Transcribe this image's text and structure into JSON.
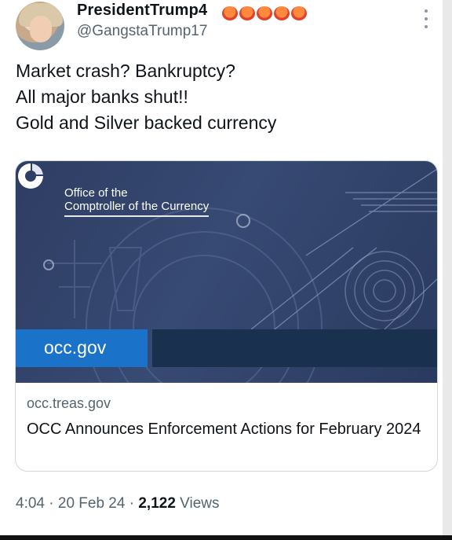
{
  "tweet": {
    "display_name": "PresidentTrump4",
    "handle": "@GangstaTrump17",
    "text_lines": [
      "Market crash? Bankruptcy?",
      "All major banks shut!!",
      "Gold and Silver backed currency"
    ],
    "emoji_icon": "orange-circle-emoji",
    "emoji_count": 5
  },
  "card": {
    "image": {
      "org_line1": "Office of the",
      "org_line2": "Comptroller of the Currency",
      "domain_badge": "occ.gov",
      "logo_icon": "occ-logo-icon",
      "colors": {
        "background": "#33456d",
        "badge": "#1a73c8",
        "dark_bar": "#19304f"
      }
    },
    "domain": "occ.treas.gov",
    "title": "OCC Announces Enforcement Actions for February 2024"
  },
  "footer": {
    "time": "4:04",
    "date": "20 Feb 24",
    "views_count": "2,122",
    "views_label": "Views",
    "separator": "·"
  },
  "more_menu_icon": "more-vertical-icon"
}
